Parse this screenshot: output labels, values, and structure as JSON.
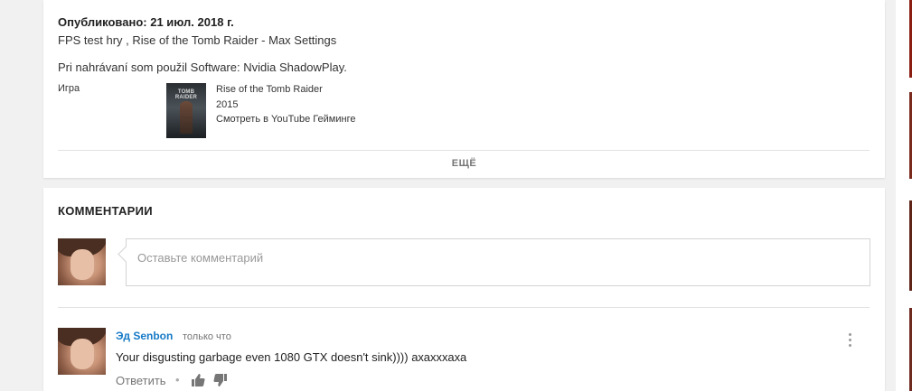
{
  "description": {
    "published": "Опубликовано: 21 июл. 2018 г.",
    "line1": "FPS test hry , Rise of the Tomb Raider - Max Settings",
    "line2": "Pri nahrávaní som použil Software: Nvidia ShadowPlay.",
    "game_label": "Игра",
    "game_thumb_text": "TOMB RAIDER",
    "game_title": "Rise of the Tomb Raider",
    "game_year": "2015",
    "game_link": "Смотреть в YouTube Гейминге",
    "more_label": "ЕЩЁ"
  },
  "comments": {
    "title": "КОММЕНТАРИИ",
    "input_placeholder": "Оставьте комментарий",
    "items": [
      {
        "author": "Эд Senbon",
        "time": "только что",
        "text": "Your disgusting garbage even 1080 GTX doesn't sink)))) ахахххаха",
        "reply_label": "Ответить",
        "separator": "•"
      }
    ]
  },
  "colors": {
    "author_link": "#167ac6",
    "background": "#f1f1f1",
    "card": "#ffffff"
  },
  "icons": {
    "like": "thumbs-up-icon",
    "dislike": "thumbs-down-icon",
    "menu": "more-vertical-icon"
  }
}
